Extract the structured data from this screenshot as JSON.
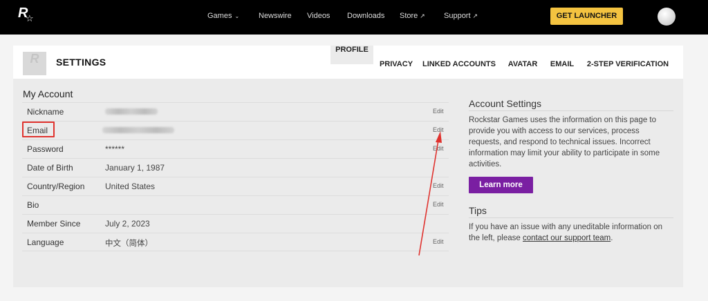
{
  "topbar": {
    "logo_letter": "R",
    "logo_star": "☆",
    "nav": [
      {
        "label": "Games",
        "suffix": "⌄"
      },
      {
        "label": "Newswire",
        "suffix": ""
      },
      {
        "label": "Videos",
        "suffix": ""
      },
      {
        "label": "Downloads",
        "suffix": ""
      },
      {
        "label": "Store",
        "suffix": "↗"
      },
      {
        "label": "Support",
        "suffix": "↗"
      }
    ],
    "launcher_label": "GET LAUNCHER"
  },
  "settings": {
    "title": "SETTINGS",
    "avatar_letter": "R",
    "tabs": [
      {
        "label": "PROFILE",
        "active": true
      },
      {
        "label": "PRIVACY",
        "active": false
      },
      {
        "label": "LINKED ACCOUNTS",
        "active": false
      },
      {
        "label": "AVATAR",
        "active": false
      },
      {
        "label": "EMAIL",
        "active": false
      },
      {
        "label": "2-STEP VERIFICATION",
        "active": false
      }
    ]
  },
  "account": {
    "title": "My Account",
    "rows": [
      {
        "label": "Nickname",
        "value": "",
        "blurred": true,
        "edit": "Edit"
      },
      {
        "label": "Email",
        "value": "",
        "blurred": true,
        "edit": "Edit"
      },
      {
        "label": "Password",
        "value": "******",
        "blurred": false,
        "edit": "Edit"
      },
      {
        "label": "Date of Birth",
        "value": "January 1, 1987",
        "blurred": false,
        "edit": ""
      },
      {
        "label": "Country/Region",
        "value": "United States",
        "blurred": false,
        "edit": "Edit"
      },
      {
        "label": "Bio",
        "value": "",
        "blurred": false,
        "edit": "Edit"
      },
      {
        "label": "Member Since",
        "value": "July 2, 2023",
        "blurred": false,
        "edit": ""
      },
      {
        "label": "Language",
        "value": "中文（简体）",
        "blurred": false,
        "edit": "Edit"
      }
    ]
  },
  "sidebar": {
    "account_settings_title": "Account Settings",
    "account_settings_text": "Rockstar Games uses the information on this page to provide you with access to our services, process requests, and respond to technical issues. Incorrect information may limit your ability to participate in some activities.",
    "learn_more_label": "Learn more",
    "tips_title": "Tips",
    "tips_text_before": "If you have an issue with any uneditable information on the left, please ",
    "tips_link": "contact our support team",
    "tips_text_after": "."
  },
  "colors": {
    "accent_launcher": "#f4c340",
    "accent_learn_more": "#7a1fa2",
    "annotation": "#e0322e"
  },
  "icons": {
    "logo": "rockstar-logo-icon",
    "external": "external-link-icon",
    "dropdown": "chevron-down-icon"
  }
}
